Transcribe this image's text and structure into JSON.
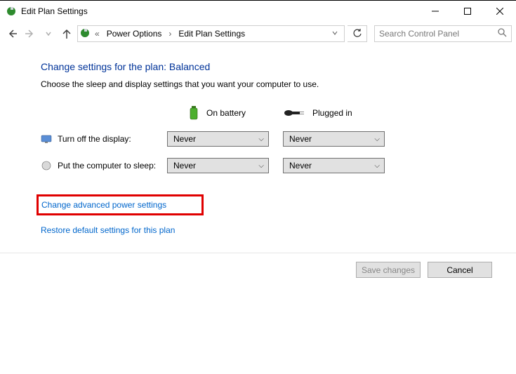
{
  "window": {
    "title": "Edit Plan Settings"
  },
  "breadcrumbs": {
    "root": "Power Options",
    "current": "Edit Plan Settings"
  },
  "search": {
    "placeholder": "Search Control Panel"
  },
  "page": {
    "title": "Change settings for the plan: Balanced",
    "subtitle": "Choose the sleep and display settings that you want your computer to use."
  },
  "columns": {
    "battery": "On battery",
    "plugged": "Plugged in"
  },
  "settings": {
    "display": {
      "label": "Turn off the display:",
      "battery_value": "Never",
      "plugged_value": "Never"
    },
    "sleep": {
      "label": "Put the computer to sleep:",
      "battery_value": "Never",
      "plugged_value": "Never"
    }
  },
  "links": {
    "advanced": "Change advanced power settings",
    "restore": "Restore default settings for this plan"
  },
  "buttons": {
    "save": "Save changes",
    "cancel": "Cancel"
  }
}
